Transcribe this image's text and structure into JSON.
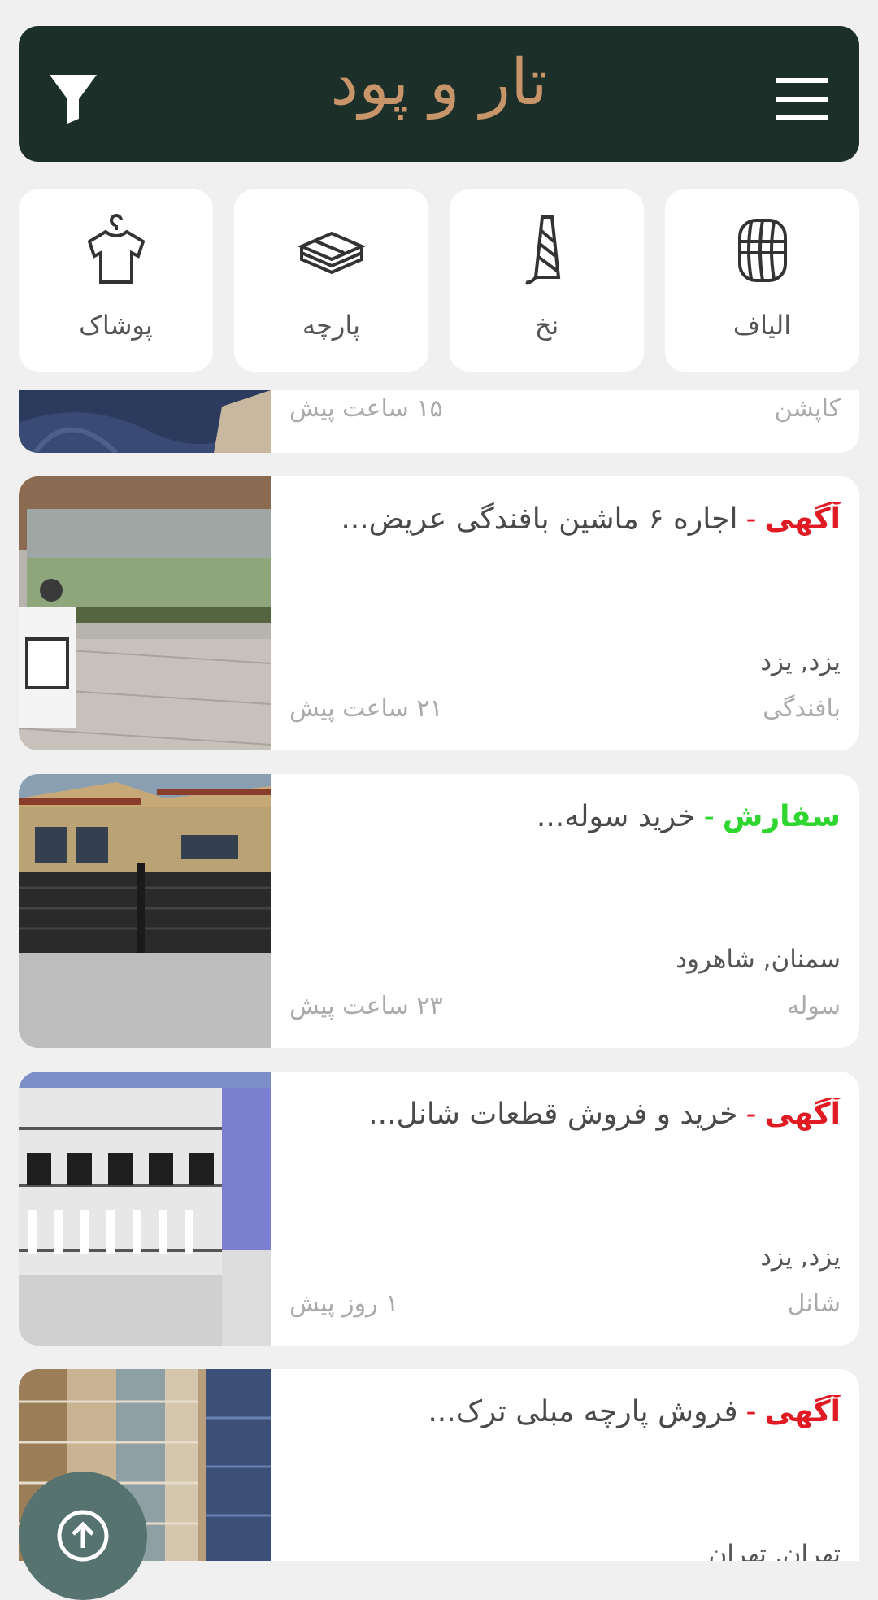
{
  "header": {
    "logo": "تار و پود"
  },
  "categories": [
    {
      "label": "الیاف",
      "icon": "yarn-ball-icon"
    },
    {
      "label": "نخ",
      "icon": "thread-spool-icon"
    },
    {
      "label": "پارچه",
      "icon": "fabric-stack-icon"
    },
    {
      "label": "پوشاک",
      "icon": "shirt-hanger-icon"
    }
  ],
  "partial_card": {
    "category": "کاپشن",
    "time": "۱۵ ساعت پیش"
  },
  "listings": [
    {
      "type": "آگهی",
      "type_color": "#e01b24",
      "sep": "-",
      "title": "اجاره ۶ ماشین بافندگی عریض...",
      "location": "یزد, یزد",
      "category": "بافندگی",
      "time": "۲۱ ساعت پیش"
    },
    {
      "type": "سفارش",
      "type_color": "#2fd62f",
      "sep": "-",
      "title": "خرید سوله...",
      "location": "سمنان, شاهرود",
      "category": "سوله",
      "time": "۲۳ ساعت پیش"
    },
    {
      "type": "آگهی",
      "type_color": "#e01b24",
      "sep": "-",
      "title": "خرید و فروش قطعات شانل...",
      "location": "یزد, یزد",
      "category": "شانل",
      "time": "۱ روز پیش"
    },
    {
      "type": "آگهی",
      "type_color": "#e01b24",
      "sep": "-",
      "title": "فروش پارچه مبلی ترک...",
      "location": "تهران, تهران",
      "category": "",
      "time": ""
    }
  ],
  "colors": {
    "header_bg": "#1c3029",
    "logo": "#c8956a",
    "fab": "#567370"
  }
}
